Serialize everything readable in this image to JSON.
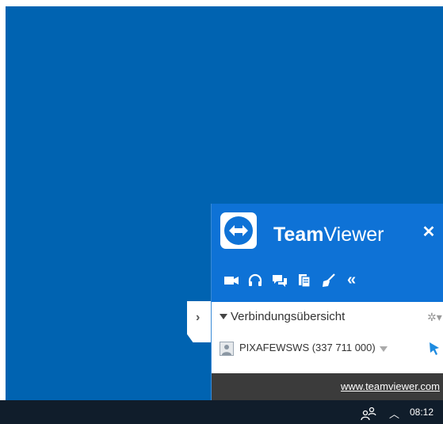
{
  "teamviewer": {
    "title_bold": "Team",
    "title_rest": "Viewer",
    "close_symbol": "✕",
    "toolbar": {
      "icons": [
        "video-icon",
        "headset-icon",
        "chat-icon",
        "clipboard-icon",
        "broom-icon",
        "double-chevron-left-icon"
      ],
      "collapse_symbol": "«"
    },
    "section": {
      "label": "Verbindungsübersicht",
      "gear_symbol": "✲▾"
    },
    "device": {
      "label": "PIXAFEWSWS (337 711 000)"
    },
    "footer_link": "www.teamviewer.com",
    "side_tab_symbol": "›",
    "colors": {
      "brand": "#0e72d6",
      "footer": "#3b3b3b"
    }
  },
  "taskbar": {
    "clock": "08:12",
    "chevron_symbol": "︿"
  },
  "desktop": {
    "background": "#0063b1"
  }
}
